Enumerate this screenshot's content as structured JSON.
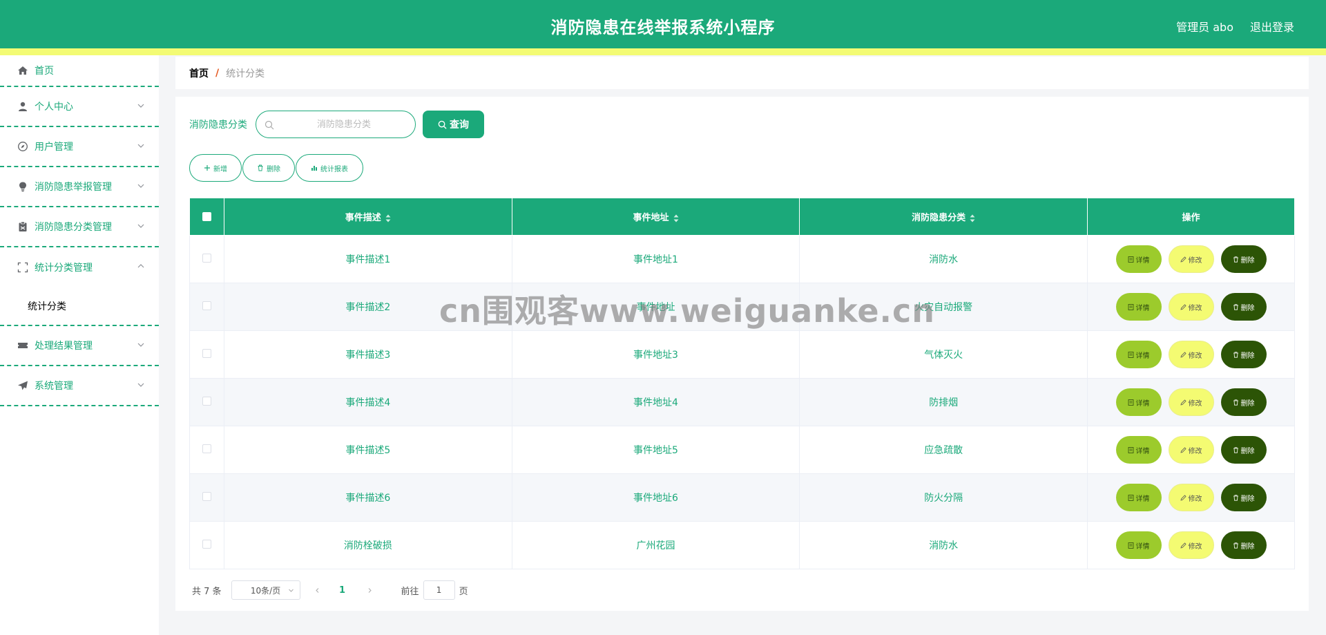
{
  "header": {
    "title": "消防隐患在线举报系统小程序",
    "user_label": "管理员 abo",
    "logout_label": "退出登录"
  },
  "sidebar": {
    "items": [
      {
        "label": "首页",
        "icon": "home-icon"
      },
      {
        "label": "个人中心",
        "icon": "user-icon"
      },
      {
        "label": "用户管理",
        "icon": "compass-icon"
      },
      {
        "label": "消防隐患举报管理",
        "icon": "bulb-icon"
      },
      {
        "label": "消防隐患分类管理",
        "icon": "clipboard-icon"
      },
      {
        "label": "统计分类管理",
        "icon": "fullscreen-icon"
      },
      {
        "label": "处理结果管理",
        "icon": "ticket-icon"
      },
      {
        "label": "系统管理",
        "icon": "send-icon"
      }
    ],
    "submenu_label": "统计分类"
  },
  "breadcrumb": {
    "home": "首页",
    "separator": "/",
    "current": "统计分类"
  },
  "search": {
    "label": "消防隐患分类",
    "placeholder": "消防隐患分类",
    "button_label": "查询"
  },
  "actions": {
    "add": "新增",
    "delete": "删除",
    "report": "统计报表"
  },
  "table": {
    "headers": {
      "desc": "事件描述",
      "addr": "事件地址",
      "cat": "消防隐患分类",
      "op": "操作"
    },
    "rows": [
      {
        "desc": "事件描述1",
        "addr": "事件地址1",
        "cat": "消防水"
      },
      {
        "desc": "事件描述2",
        "addr": "事件地址",
        "cat": "火灾自动报警"
      },
      {
        "desc": "事件描述3",
        "addr": "事件地址3",
        "cat": "气体灭火"
      },
      {
        "desc": "事件描述4",
        "addr": "事件地址4",
        "cat": "防排烟"
      },
      {
        "desc": "事件描述5",
        "addr": "事件地址5",
        "cat": "应急疏散"
      },
      {
        "desc": "事件描述6",
        "addr": "事件地址6",
        "cat": "防火分隔"
      },
      {
        "desc": "消防栓破损",
        "addr": "广州花园",
        "cat": "消防水"
      }
    ],
    "op_labels": {
      "detail": "详情",
      "edit": "修改",
      "delete": "删除"
    }
  },
  "pagination": {
    "total": "共 7 条",
    "page_size": "10条/页",
    "current_page": "1",
    "goto_prefix": "前往",
    "goto_value": "1",
    "goto_suffix": "页"
  },
  "watermark": "cn围观客www.weiguanke.cn",
  "colors": {
    "primary": "#1ba97a",
    "accent_line": "#f3fb74",
    "detail_btn": "#9ccb2c",
    "edit_btn": "#f4fb72",
    "delete_btn": "#2c5406"
  }
}
